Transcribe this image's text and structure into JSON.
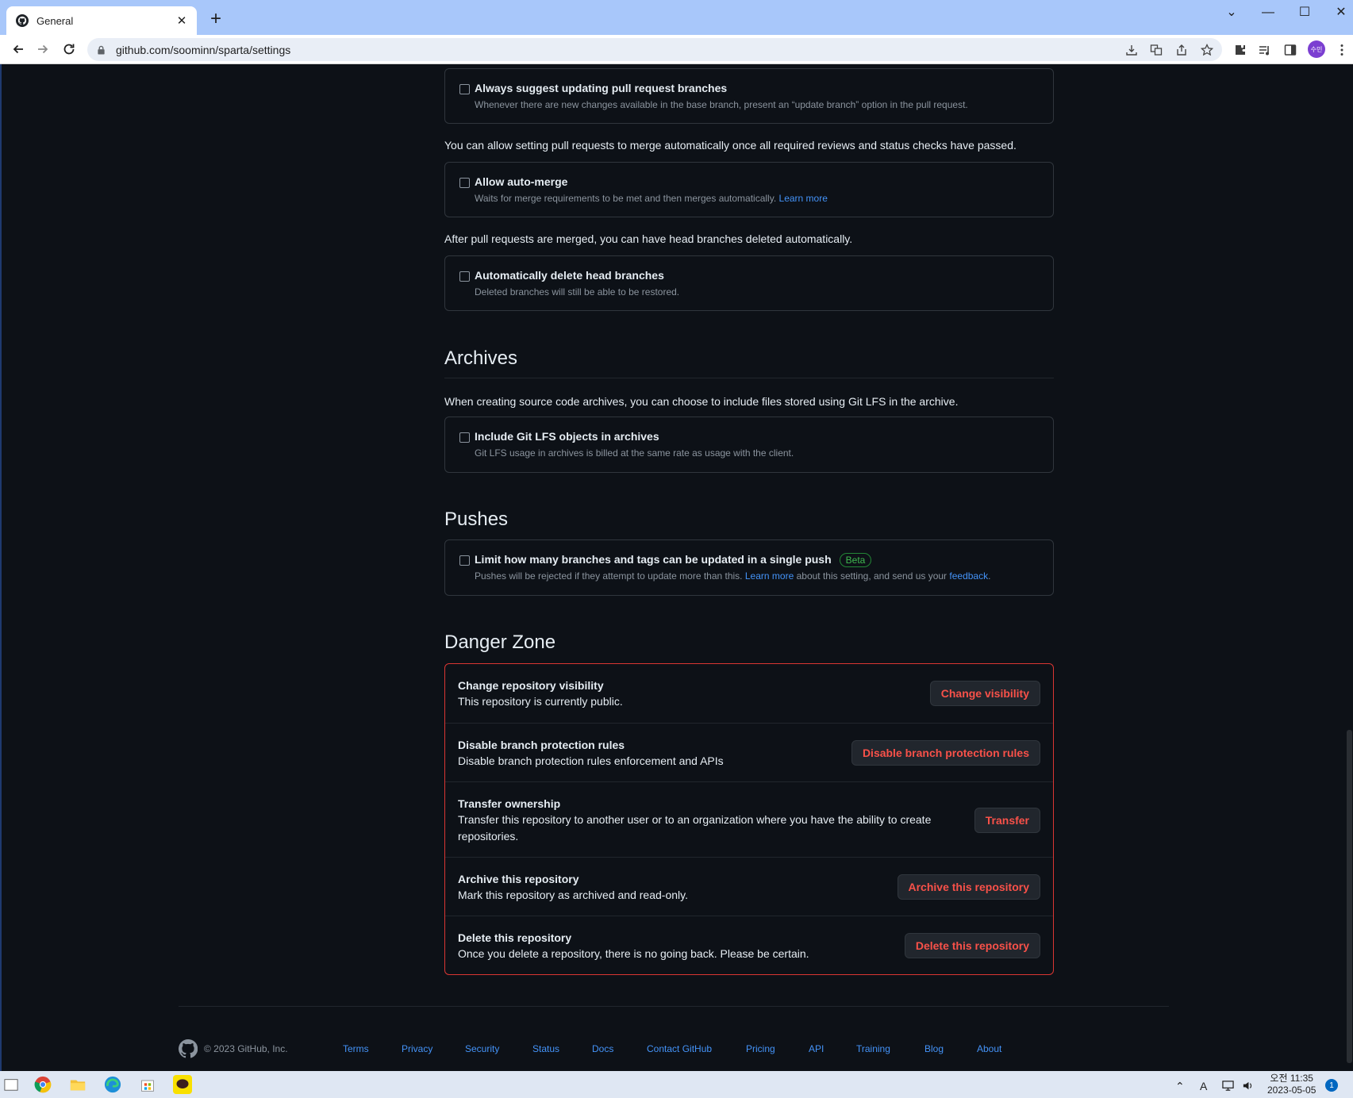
{
  "browser": {
    "tab_title": "General",
    "tab_close": "✕",
    "new_tab": "+",
    "url": "github.com/soominn/sparta/settings",
    "profile_initials": "수민",
    "window_controls": [
      "⌄",
      "—",
      "☐",
      "✕"
    ]
  },
  "merge_options": [
    {
      "title": "Always suggest updating pull request branches",
      "desc": "Whenever there are new changes available in the base branch, present an “update branch” option in the pull request.",
      "checked": false
    }
  ],
  "auto_merge": {
    "note": "You can allow setting pull requests to merge automatically once all required reviews and status checks have passed.",
    "title": "Allow auto-merge",
    "desc": "Waits for merge requirements to be met and then merges automatically.",
    "link": "Learn more",
    "checked": false
  },
  "delete_branches": {
    "note": "After pull requests are merged, you can have head branches deleted automatically.",
    "title": "Automatically delete head branches",
    "desc": "Deleted branches will still be able to be restored.",
    "checked": false
  },
  "archives": {
    "heading": "Archives",
    "note": "When creating source code archives, you can choose to include files stored using Git LFS in the archive.",
    "title": "Include Git LFS objects in archives",
    "desc": "Git LFS usage in archives is billed at the same rate as usage with the client.",
    "checked": false
  },
  "pushes": {
    "heading": "Pushes",
    "title": "Limit how many branches and tags can be updated in a single push",
    "badge": "Beta",
    "desc_before": "Pushes will be rejected if they attempt to update more than this.",
    "learn_more": "Learn more",
    "desc_middle": "about this setting, and send us your",
    "feedback": "feedback",
    "desc_end": ".",
    "checked": false
  },
  "danger_zone": {
    "heading": "Danger Zone",
    "rows": [
      {
        "title": "Change repository visibility",
        "desc": "This repository is currently public.",
        "button": "Change visibility"
      },
      {
        "title": "Disable branch protection rules",
        "desc": "Disable branch protection rules enforcement and APIs",
        "button": "Disable branch protection rules"
      },
      {
        "title": "Transfer ownership",
        "desc": "Transfer this repository to another user or to an organization where you have the ability to create repositories.",
        "button": "Transfer"
      },
      {
        "title": "Archive this repository",
        "desc": "Mark this repository as archived and read-only.",
        "button": "Archive this repository"
      },
      {
        "title": "Delete this repository",
        "desc": "Once you delete a repository, there is no going back. Please be certain.",
        "button": "Delete this repository"
      }
    ]
  },
  "footer": {
    "copyright": "© 2023 GitHub, Inc.",
    "links": [
      "Terms",
      "Privacy",
      "Security",
      "Status",
      "Docs",
      "Contact GitHub",
      "Pricing",
      "API",
      "Training",
      "Blog",
      "About"
    ]
  },
  "taskbar": {
    "time": "오전 11:35",
    "date": "2023-05-05",
    "notifications": "1",
    "ime": "A"
  },
  "colors": {
    "bg": "#0d1117",
    "border": "#30363d",
    "danger": "#f85149",
    "link": "#4493f8",
    "beta": "#3fb950"
  }
}
